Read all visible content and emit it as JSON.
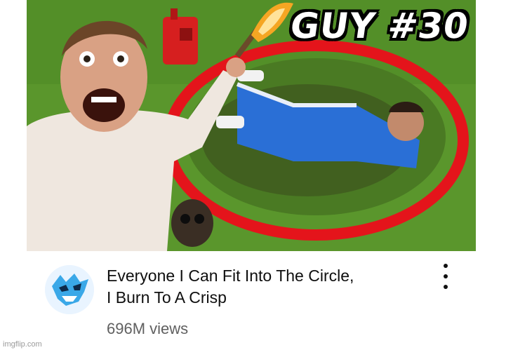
{
  "thumbnail": {
    "overlay_text": "GUY #30"
  },
  "video": {
    "title_line1": "Everyone I Can Fit Into The Circle,",
    "title_line2": "I Burn To A Crisp",
    "views": "696M views"
  },
  "icons": {
    "more": "more-vert-icon",
    "avatar": "beast-logo-icon"
  },
  "colors": {
    "circle_red": "#e4141b",
    "grass_green": "#5f9b2f",
    "suit_blue": "#2a6fd6",
    "title_text": "#0f0f0f",
    "meta_text": "#606060",
    "avatar_accent": "#3aa8e8"
  },
  "watermark": "imgflip.com"
}
